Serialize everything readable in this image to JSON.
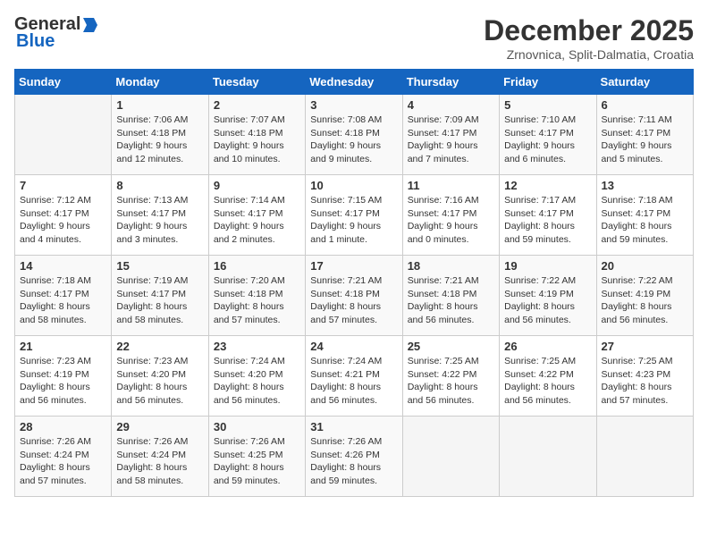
{
  "logo": {
    "general": "General",
    "blue": "Blue"
  },
  "title": "December 2025",
  "subtitle": "Zrnovnica, Split-Dalmatia, Croatia",
  "days_header": [
    "Sunday",
    "Monday",
    "Tuesday",
    "Wednesday",
    "Thursday",
    "Friday",
    "Saturday"
  ],
  "weeks": [
    [
      {
        "day": "",
        "info": ""
      },
      {
        "day": "1",
        "info": "Sunrise: 7:06 AM\nSunset: 4:18 PM\nDaylight: 9 hours\nand 12 minutes."
      },
      {
        "day": "2",
        "info": "Sunrise: 7:07 AM\nSunset: 4:18 PM\nDaylight: 9 hours\nand 10 minutes."
      },
      {
        "day": "3",
        "info": "Sunrise: 7:08 AM\nSunset: 4:18 PM\nDaylight: 9 hours\nand 9 minutes."
      },
      {
        "day": "4",
        "info": "Sunrise: 7:09 AM\nSunset: 4:17 PM\nDaylight: 9 hours\nand 7 minutes."
      },
      {
        "day": "5",
        "info": "Sunrise: 7:10 AM\nSunset: 4:17 PM\nDaylight: 9 hours\nand 6 minutes."
      },
      {
        "day": "6",
        "info": "Sunrise: 7:11 AM\nSunset: 4:17 PM\nDaylight: 9 hours\nand 5 minutes."
      }
    ],
    [
      {
        "day": "7",
        "info": "Sunrise: 7:12 AM\nSunset: 4:17 PM\nDaylight: 9 hours\nand 4 minutes."
      },
      {
        "day": "8",
        "info": "Sunrise: 7:13 AM\nSunset: 4:17 PM\nDaylight: 9 hours\nand 3 minutes."
      },
      {
        "day": "9",
        "info": "Sunrise: 7:14 AM\nSunset: 4:17 PM\nDaylight: 9 hours\nand 2 minutes."
      },
      {
        "day": "10",
        "info": "Sunrise: 7:15 AM\nSunset: 4:17 PM\nDaylight: 9 hours\nand 1 minute."
      },
      {
        "day": "11",
        "info": "Sunrise: 7:16 AM\nSunset: 4:17 PM\nDaylight: 9 hours\nand 0 minutes."
      },
      {
        "day": "12",
        "info": "Sunrise: 7:17 AM\nSunset: 4:17 PM\nDaylight: 8 hours\nand 59 minutes."
      },
      {
        "day": "13",
        "info": "Sunrise: 7:18 AM\nSunset: 4:17 PM\nDaylight: 8 hours\nand 59 minutes."
      }
    ],
    [
      {
        "day": "14",
        "info": "Sunrise: 7:18 AM\nSunset: 4:17 PM\nDaylight: 8 hours\nand 58 minutes."
      },
      {
        "day": "15",
        "info": "Sunrise: 7:19 AM\nSunset: 4:17 PM\nDaylight: 8 hours\nand 58 minutes."
      },
      {
        "day": "16",
        "info": "Sunrise: 7:20 AM\nSunset: 4:18 PM\nDaylight: 8 hours\nand 57 minutes."
      },
      {
        "day": "17",
        "info": "Sunrise: 7:21 AM\nSunset: 4:18 PM\nDaylight: 8 hours\nand 57 minutes."
      },
      {
        "day": "18",
        "info": "Sunrise: 7:21 AM\nSunset: 4:18 PM\nDaylight: 8 hours\nand 56 minutes."
      },
      {
        "day": "19",
        "info": "Sunrise: 7:22 AM\nSunset: 4:19 PM\nDaylight: 8 hours\nand 56 minutes."
      },
      {
        "day": "20",
        "info": "Sunrise: 7:22 AM\nSunset: 4:19 PM\nDaylight: 8 hours\nand 56 minutes."
      }
    ],
    [
      {
        "day": "21",
        "info": "Sunrise: 7:23 AM\nSunset: 4:19 PM\nDaylight: 8 hours\nand 56 minutes."
      },
      {
        "day": "22",
        "info": "Sunrise: 7:23 AM\nSunset: 4:20 PM\nDaylight: 8 hours\nand 56 minutes."
      },
      {
        "day": "23",
        "info": "Sunrise: 7:24 AM\nSunset: 4:20 PM\nDaylight: 8 hours\nand 56 minutes."
      },
      {
        "day": "24",
        "info": "Sunrise: 7:24 AM\nSunset: 4:21 PM\nDaylight: 8 hours\nand 56 minutes."
      },
      {
        "day": "25",
        "info": "Sunrise: 7:25 AM\nSunset: 4:22 PM\nDaylight: 8 hours\nand 56 minutes."
      },
      {
        "day": "26",
        "info": "Sunrise: 7:25 AM\nSunset: 4:22 PM\nDaylight: 8 hours\nand 56 minutes."
      },
      {
        "day": "27",
        "info": "Sunrise: 7:25 AM\nSunset: 4:23 PM\nDaylight: 8 hours\nand 57 minutes."
      }
    ],
    [
      {
        "day": "28",
        "info": "Sunrise: 7:26 AM\nSunset: 4:24 PM\nDaylight: 8 hours\nand 57 minutes."
      },
      {
        "day": "29",
        "info": "Sunrise: 7:26 AM\nSunset: 4:24 PM\nDaylight: 8 hours\nand 58 minutes."
      },
      {
        "day": "30",
        "info": "Sunrise: 7:26 AM\nSunset: 4:25 PM\nDaylight: 8 hours\nand 59 minutes."
      },
      {
        "day": "31",
        "info": "Sunrise: 7:26 AM\nSunset: 4:26 PM\nDaylight: 8 hours\nand 59 minutes."
      },
      {
        "day": "",
        "info": ""
      },
      {
        "day": "",
        "info": ""
      },
      {
        "day": "",
        "info": ""
      }
    ]
  ]
}
